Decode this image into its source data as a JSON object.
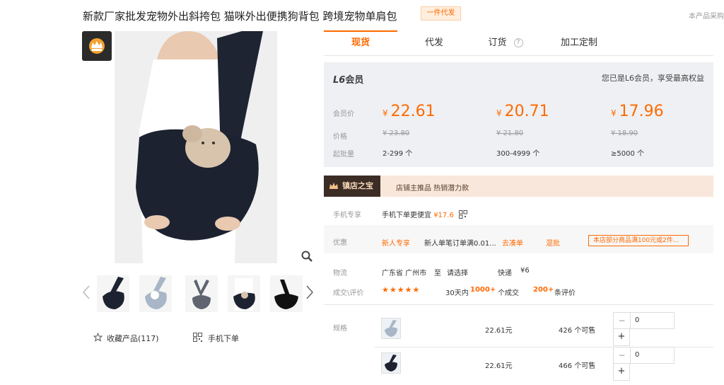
{
  "product": {
    "title": "新款厂家批发宠物外出斜挎包 猫咪外出便携狗背包 跨境宠物单肩包",
    "badge": "一件代发",
    "top_right_note": "本产品采购"
  },
  "gallery": {
    "favorite_label": "收藏产品(117)",
    "mobile_order_label": "手机下单"
  },
  "tabs": [
    "现货",
    "代发",
    "订货",
    "加工定制"
  ],
  "tab_help": "?",
  "member": {
    "level_prefix": "L6",
    "level_suffix": "会员",
    "note": "您已是L6会员，享受最高权益",
    "labels": {
      "member_price": "会员价",
      "price": "价格",
      "min_order": "起批量"
    },
    "currency": "¥",
    "tiers": [
      {
        "member_price": "22.61",
        "price": "¥ 23.80",
        "qty": "2-299 个"
      },
      {
        "member_price": "20.71",
        "price": "¥ 21.80",
        "qty": "300-4999 个"
      },
      {
        "member_price": "17.96",
        "price": "¥ 18.90",
        "qty": "≥5000 个"
      }
    ]
  },
  "treasure": {
    "badge": "镇店之宝",
    "text": "店铺主推品  热销潜力款"
  },
  "info": {
    "mobile_label": "手机专享",
    "mobile_text": "手机下单更便宜",
    "mobile_price": "¥17.6",
    "coupon_label": "优惠",
    "coupon_new": "新人专享",
    "coupon_text": "新人单笔订单满0.01...",
    "coupon_link": "去凑单",
    "coupon_mix": "混批",
    "coupon_store": "本店部分商品满100元或2件...",
    "logistics_label": "物流",
    "logistics_from": "广东省 广州市",
    "logistics_to_word": "至",
    "logistics_select": "请选择",
    "logistics_express": "快递",
    "logistics_fee": "¥6",
    "deal_label": "成交\\评价",
    "stars": "★★★★★",
    "deal_prefix": "30天内",
    "deal_count": "1000+",
    "deal_suffix": "个成交",
    "review_count": "200+",
    "review_suffix": "条评价"
  },
  "specs": {
    "label": "规格",
    "rows": [
      {
        "price": "22.61元",
        "stock": "426 个可售",
        "qty": "0"
      },
      {
        "price": "22.61元",
        "stock": "466 个可售",
        "qty": "0"
      }
    ],
    "minus": "−",
    "plus": "+"
  }
}
